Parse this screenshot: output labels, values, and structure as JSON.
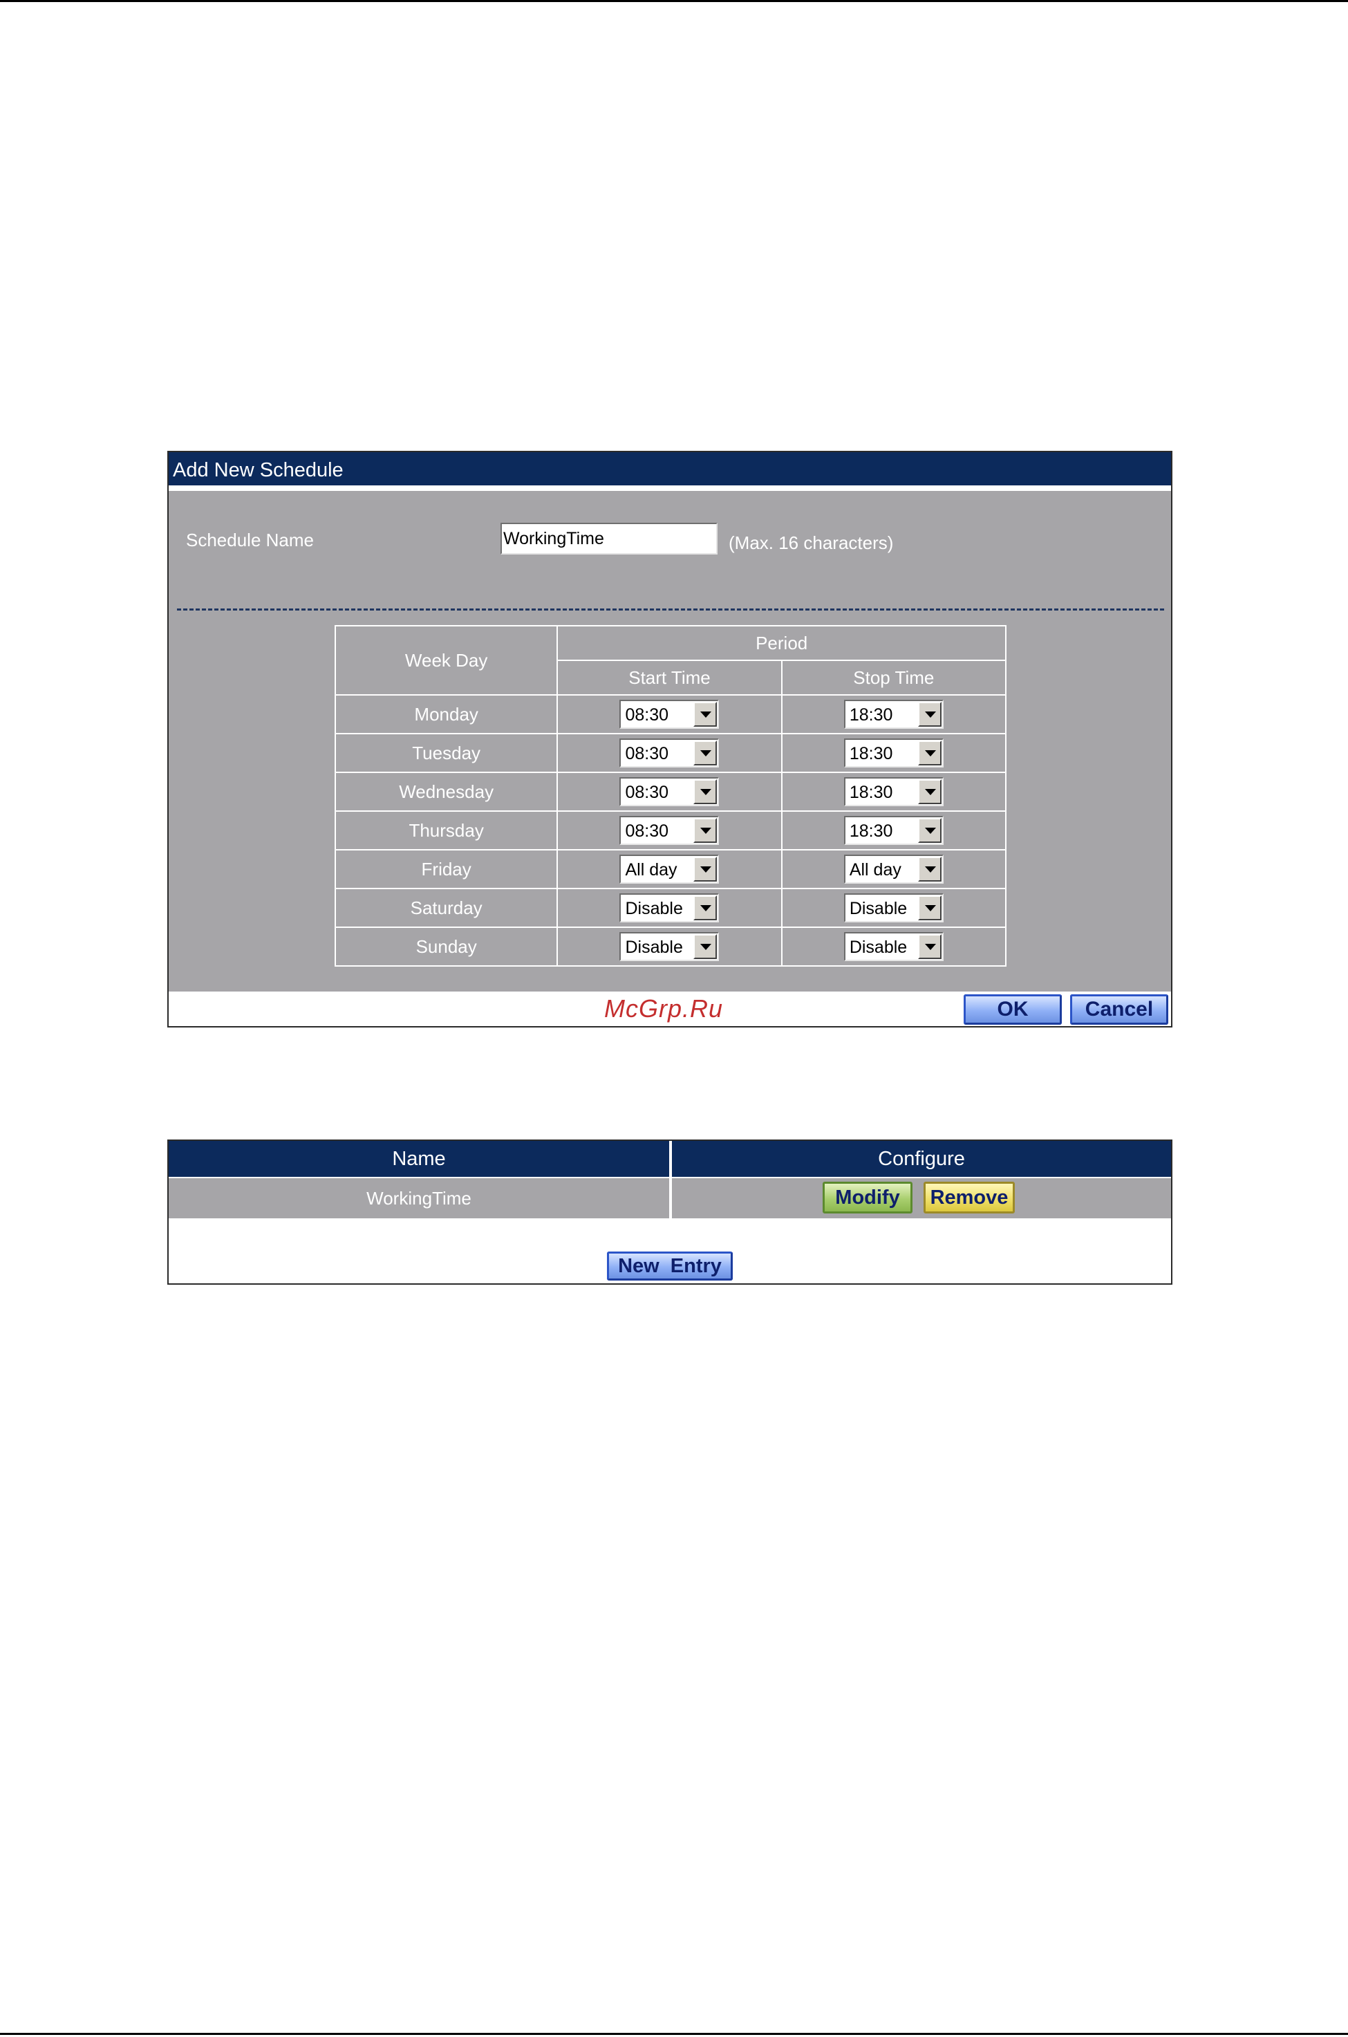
{
  "schedule_form": {
    "title": "Add New Schedule",
    "name_label": "Schedule Name",
    "name_value": "WorkingTime",
    "name_hint": "(Max. 16 characters)",
    "table": {
      "weekday_header": "Week Day",
      "period_header": "Period",
      "start_header": "Start Time",
      "stop_header": "Stop Time",
      "rows": [
        {
          "day": "Monday",
          "start": "08:30",
          "stop": "18:30"
        },
        {
          "day": "Tuesday",
          "start": "08:30",
          "stop": "18:30"
        },
        {
          "day": "Wednesday",
          "start": "08:30",
          "stop": "18:30"
        },
        {
          "day": "Thursday",
          "start": "08:30",
          "stop": "18:30"
        },
        {
          "day": "Friday",
          "start": "All day",
          "stop": "All day"
        },
        {
          "day": "Saturday",
          "start": "Disable",
          "stop": "Disable"
        },
        {
          "day": "Sunday",
          "start": "Disable",
          "stop": "Disable"
        }
      ]
    },
    "ok_label": "OK",
    "cancel_label": "Cancel"
  },
  "watermark": "McGrp.Ru",
  "schedule_list": {
    "columns": [
      "Name",
      "Configure"
    ],
    "rows": [
      {
        "name": "WorkingTime",
        "modify_label": "Modify",
        "remove_label": "Remove"
      }
    ],
    "new_entry_label": "New  Entry"
  },
  "colors": {
    "header_navy": "#0c2a5c",
    "panel_gray": "#a6a5a8",
    "button_blue": "#8fb0f6",
    "button_green": "#a9cf6e",
    "button_yellow": "#f0e06a",
    "watermark_red": "#c42e2e"
  }
}
